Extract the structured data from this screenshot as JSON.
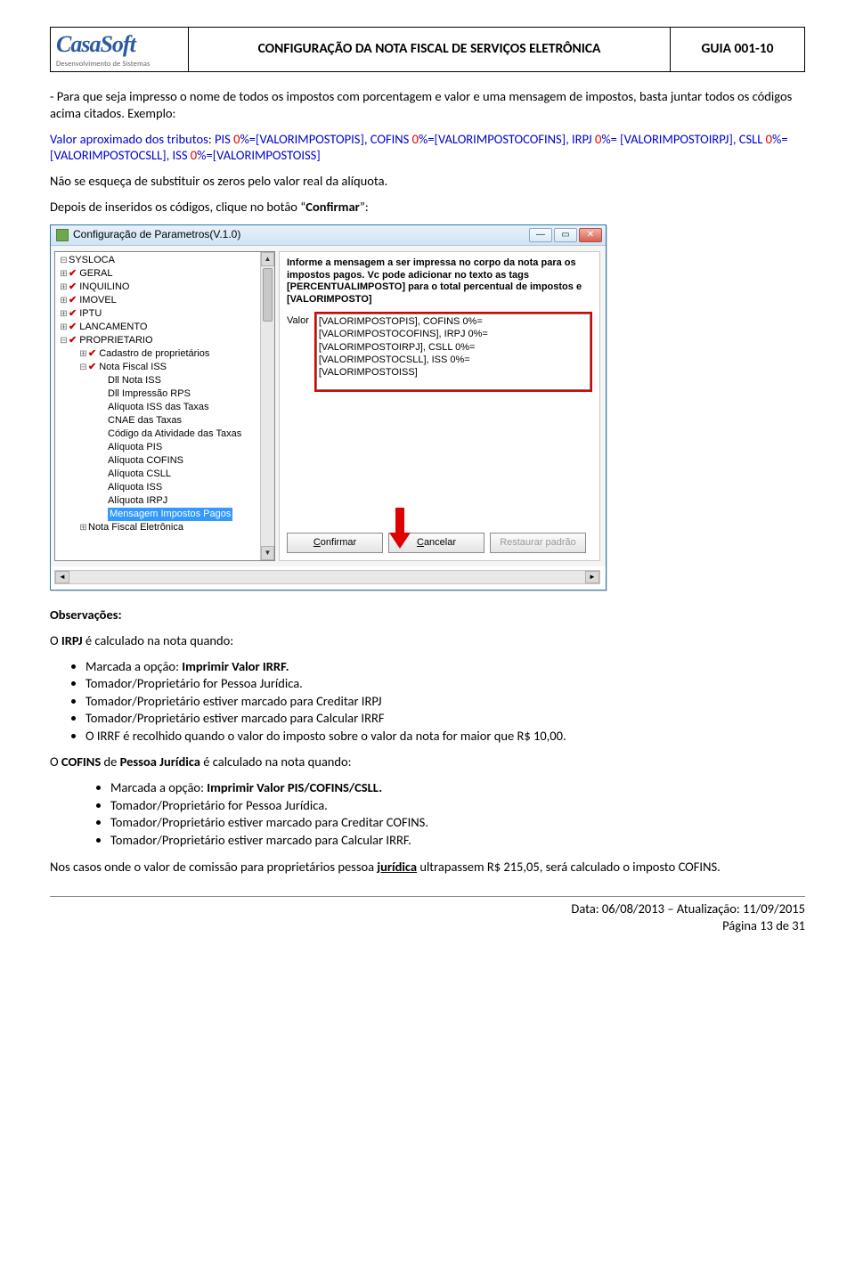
{
  "header": {
    "logo_top": "CasaSoft",
    "logo_sub": "Desenvolvimento de Sistemas",
    "title": "CONFIGURAÇÃO DA NOTA FISCAL DE SERVIÇOS ELETRÔNICA",
    "guia": "GUIA 001-10"
  },
  "para1": "- Para que seja impresso o nome de todos os impostos com porcentagem e valor e uma mensagem de impostos, basta juntar todos os códigos acima citados. Exemplo:",
  "exemplo": {
    "pre": "Valor aproximado dos tributos: PIS ",
    "z1": "0",
    "t1": "%=[VALORIMPOSTOPIS], COFINS ",
    "z2": "0",
    "t2": "%=[VALORIMPOSTOCOFINS], IRPJ ",
    "z3": "0",
    "t3": "%= [VALORIMPOSTOIRPJ], CSLL ",
    "z4": "0",
    "t4": "%= [VALORIMPOSTOCSLL], ISS ",
    "z5": "0",
    "t5": "%=[VALORIMPOSTOISS]"
  },
  "para2": "Não se esqueça de substituir os zeros pelo valor real da alíquota.",
  "para3_a": "Depois de inseridos os códigos, clique no botão “",
  "para3_b": "Confirmar",
  "para3_c": "”:",
  "screenshot": {
    "title": "Configuração de Parametros(V.1.0)",
    "tree": {
      "sysloca": "SYSLOCA",
      "geral": "GERAL",
      "inquilino": "INQUILINO",
      "imovel": "IMOVEL",
      "iptu": "IPTU",
      "lancamento": "LANCAMENTO",
      "proprietario": "PROPRIETARIO",
      "cad_prop": "Cadastro de proprietários",
      "nfiss": "Nota Fiscal ISS",
      "dll_nota": "Dll Nota ISS",
      "dll_rps": "Dll Impressão RPS",
      "aliq_taxas": "Alíquota ISS das Taxas",
      "cnae": "CNAE das Taxas",
      "cod_ativ": "Código da Atividade das Taxas",
      "aliq_pis": "Alíquota PIS",
      "aliq_cofins": "Alíquota COFINS",
      "aliq_csll": "Alíquota CSLL",
      "aliq_iss": "Alíquota ISS",
      "aliq_irpj": "Alíquota IRPJ",
      "msg_imp": "Mensagem Impostos Pagos",
      "nfe": "Nota Fiscal Eletrônica"
    },
    "right": {
      "msg": "Informe a mensagem a ser impressa no corpo da nota para os impostos pagos. Vc pode adicionar no texto as tags [PERCENTUALIMPOSTO] para o total percentual de impostos e [VALORIMPOSTO]",
      "valor_label": "Valor",
      "textarea": "[VALORIMPOSTOPIS], COFINS 0%=\n[VALORIMPOSTOCOFINS], IRPJ 0%=\n[VALORIMPOSTOIRPJ], CSLL 0%=\n[VALORIMPOSTOCSLL], ISS 0%=\n[VALORIMPOSTOISS]",
      "btn_confirm": "Confirmar",
      "btn_cancel": "Cancelar",
      "btn_restore": "Restaurar padrão"
    }
  },
  "obs_heading": "Observações:",
  "irpj_line_a": "O ",
  "irpj_line_b": "IRPJ",
  "irpj_line_c": " é calculado na nota quando:",
  "irpj_bullets": {
    "b1a": "Marcada a opção: ",
    "b1b": "Imprimir Valor IRRF.",
    "b2": "Tomador/Proprietário for Pessoa Jurídica.",
    "b3": "Tomador/Proprietário estiver marcado para Creditar IRPJ",
    "b4": "Tomador/Proprietário estiver marcado para Calcular IRRF",
    "b5": "O IRRF é recolhido quando o valor do imposto sobre o valor da nota for maior que R$ 10,00."
  },
  "cofins_a": "O ",
  "cofins_b": "COFINS",
  "cofins_c": " de ",
  "cofins_d": "Pessoa Jurídica",
  "cofins_e": " é calculado na nota quando:",
  "cofins_bullets": {
    "b1a": "Marcada a opção: ",
    "b1b": "Imprimir Valor PIS/COFINS/CSLL.",
    "b2": "Tomador/Proprietário for Pessoa Jurídica.",
    "b3": "Tomador/Proprietário estiver marcado para Creditar COFINS.",
    "b4": "Tomador/Proprietário estiver marcado para Calcular IRRF."
  },
  "final_a": "Nos casos onde o valor de comissão para proprietários pessoa ",
  "final_b": "jurídica",
  "final_c": " ultrapassem R$ 215,05, será calculado o imposto COFINS.",
  "footer": {
    "line1": "Data: 06/08/2013 – Atualização: 11/09/2015",
    "line2": "Página 13 de 31"
  }
}
